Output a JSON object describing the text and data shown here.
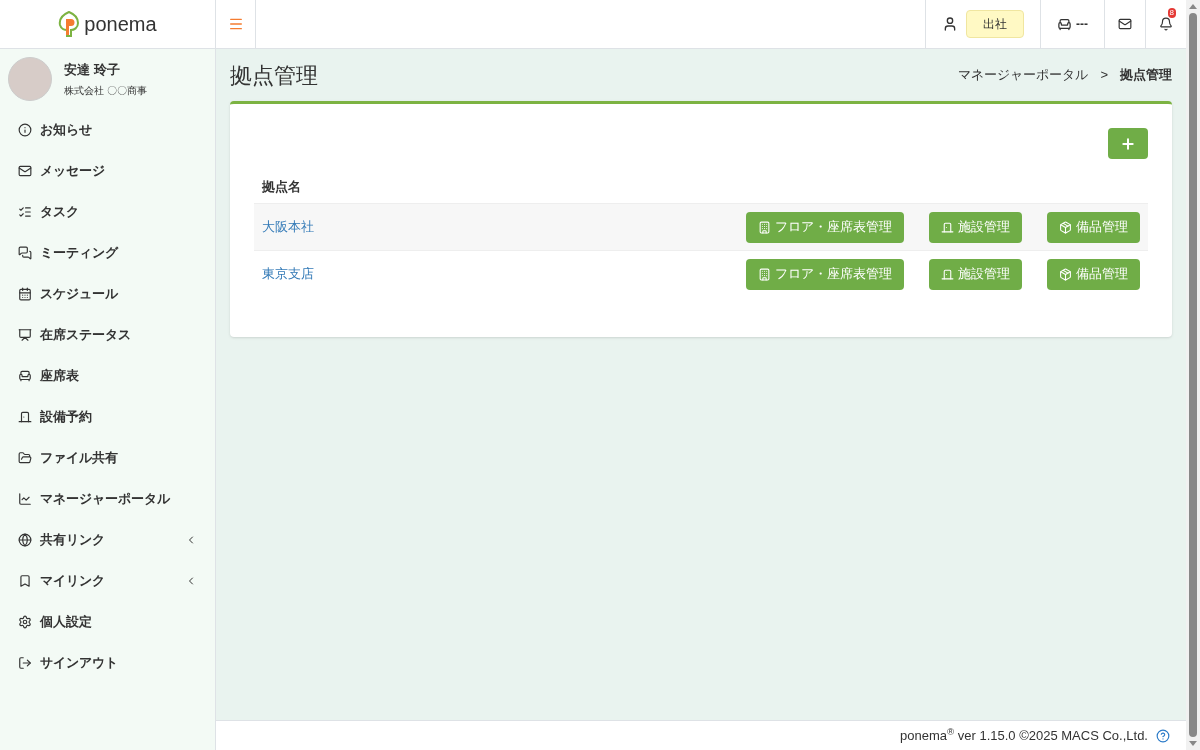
{
  "header": {
    "logo": "ponema",
    "attendance_status": "出社",
    "seat": "---",
    "notification_count": "8"
  },
  "user": {
    "name": "安達 玲子",
    "company": "株式会社 〇〇商事"
  },
  "sidebar": {
    "items": [
      {
        "label": "お知らせ",
        "kind": "link"
      },
      {
        "label": "メッセージ",
        "kind": "link"
      },
      {
        "label": "タスク",
        "kind": "link"
      },
      {
        "label": "ミーティング",
        "kind": "link"
      },
      {
        "label": "スケジュール",
        "kind": "link"
      },
      {
        "label": "在席ステータス",
        "kind": "link"
      },
      {
        "label": "座席表",
        "kind": "link"
      },
      {
        "label": "設備予約",
        "kind": "link"
      },
      {
        "label": "ファイル共有",
        "kind": "link"
      },
      {
        "label": "マネージャーポータル",
        "kind": "link"
      },
      {
        "label": "共有リンク",
        "kind": "group",
        "expanded": false
      },
      {
        "label": "マイリンク",
        "kind": "group",
        "expanded": false
      },
      {
        "label": "個人設定",
        "kind": "link"
      },
      {
        "label": "サインアウト",
        "kind": "link"
      }
    ]
  },
  "page": {
    "title": "拠点管理",
    "breadcrumb": [
      "マネージャーポータル",
      "拠点管理"
    ],
    "breadcrumb_separator": ">"
  },
  "table": {
    "columns": [
      "拠点名"
    ],
    "rows": [
      {
        "name": "大阪本社",
        "actions": [
          "フロア・座席表管理",
          "施設管理",
          "備品管理"
        ]
      },
      {
        "name": "東京支店",
        "actions": [
          "フロア・座席表管理",
          "施設管理",
          "備品管理"
        ]
      }
    ]
  },
  "footer": {
    "text": "ponema$^{®}$ ver 1.15.0 ©2025 MACS Co.,Ltd."
  }
}
